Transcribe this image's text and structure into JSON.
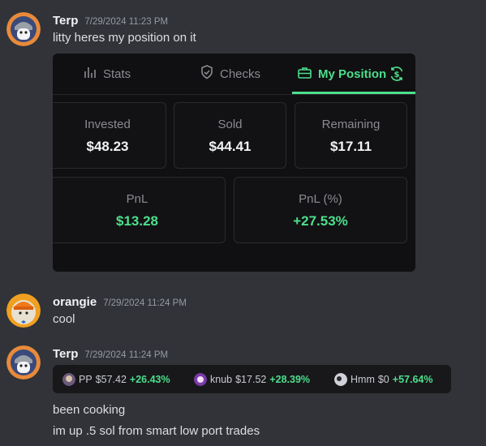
{
  "messages": [
    {
      "username": "Terp",
      "timestamp": "7/29/2024 11:23 PM",
      "text": "litty heres my position on it"
    },
    {
      "username": "orangie",
      "timestamp": "7/29/2024 11:24 PM",
      "text": "cool"
    },
    {
      "username": "Terp",
      "timestamp": "7/29/2024 11:24 PM",
      "lines": [
        "been cooking",
        "im up .5 sol from smart low port trades"
      ]
    }
  ],
  "position_card": {
    "tabs": [
      {
        "label": "Stats",
        "icon": "bar-chart-icon"
      },
      {
        "label": "Checks",
        "icon": "shield-check-icon"
      },
      {
        "label": "My Position",
        "icon": "briefcase-icon",
        "active": true
      }
    ],
    "refresh_icon": "refresh-dollar-icon",
    "stats": [
      {
        "label": "Invested",
        "value": "$48.23"
      },
      {
        "label": "Sold",
        "value": "$44.41"
      },
      {
        "label": "Remaining",
        "value": "$17.11"
      },
      {
        "label": "PnL",
        "value": "$13.28"
      },
      {
        "label": "PnL (%)",
        "value": "+27.53%"
      }
    ]
  },
  "coin_strip": [
    {
      "name": "PP",
      "price": "$57.42",
      "change": "+26.43%"
    },
    {
      "name": "knub",
      "price": "$17.52",
      "change": "+28.39%"
    },
    {
      "name": "Hmm",
      "price": "$0",
      "change": "+57.64%"
    }
  ],
  "colors": {
    "accent": "#4ddf8b",
    "background": "#313338",
    "card": "#101012"
  }
}
